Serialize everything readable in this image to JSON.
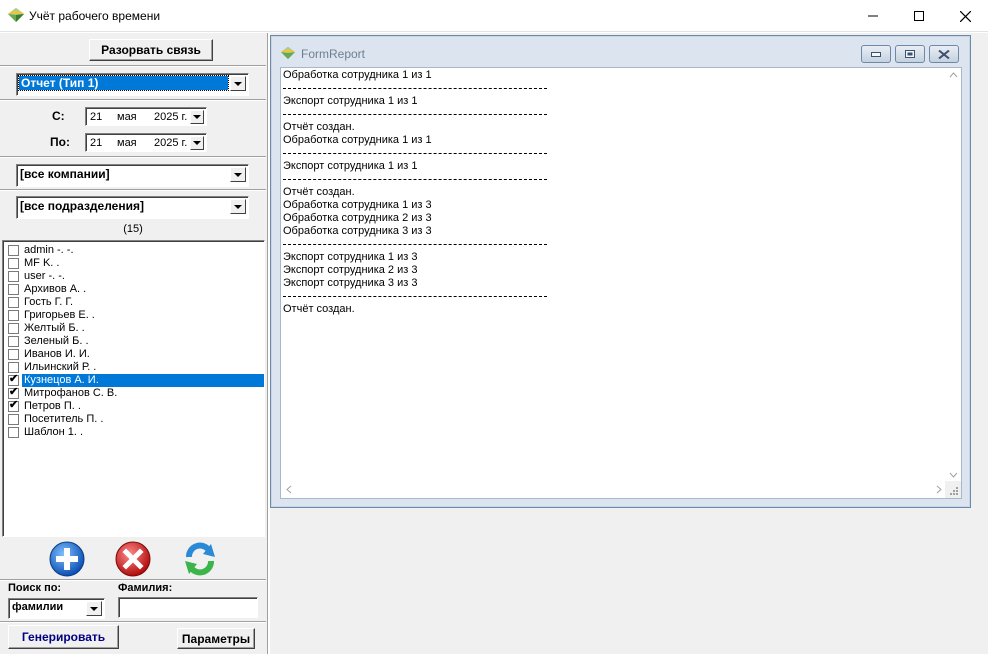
{
  "window": {
    "title": "Учёт рабочего времени"
  },
  "left": {
    "disconnect_label": "Разорвать связь",
    "report_type": "Отчет (Тип 1)",
    "from_label": "С:",
    "to_label": "По:",
    "date_from": {
      "day": "21",
      "month": "мая",
      "year": "2025 г."
    },
    "date_to": {
      "day": "21",
      "month": "мая",
      "year": "2025 г."
    },
    "company": "[все компании]",
    "department": "[все подразделения]",
    "count": "(15)",
    "employees": [
      {
        "name": "admin -. -.",
        "checked": false,
        "selected": false
      },
      {
        "name": "MF K. .",
        "checked": false,
        "selected": false
      },
      {
        "name": "user -. -.",
        "checked": false,
        "selected": false
      },
      {
        "name": "Архивов А. .",
        "checked": false,
        "selected": false
      },
      {
        "name": "Гость Г. Г.",
        "checked": false,
        "selected": false
      },
      {
        "name": "Григорьев Е. .",
        "checked": false,
        "selected": false
      },
      {
        "name": "Желтый Б. .",
        "checked": false,
        "selected": false
      },
      {
        "name": "Зеленый Б. .",
        "checked": false,
        "selected": false
      },
      {
        "name": "Иванов И. И.",
        "checked": false,
        "selected": false
      },
      {
        "name": "Ильинский Р. .",
        "checked": false,
        "selected": false
      },
      {
        "name": "Кузнецов А. И.",
        "checked": true,
        "selected": true
      },
      {
        "name": "Митрофанов С. В.",
        "checked": true,
        "selected": false
      },
      {
        "name": "Петров П. .",
        "checked": true,
        "selected": false
      },
      {
        "name": "Посетитель П. .",
        "checked": false,
        "selected": false
      },
      {
        "name": "Шаблон 1. .",
        "checked": false,
        "selected": false
      }
    ],
    "search_by_label": "Поиск по:",
    "search_by_value": "фамилии",
    "lastname_label": "Фамилия:",
    "lastname_value": "",
    "generate_label": "Генерировать",
    "params_label": "Параметры"
  },
  "report_window": {
    "title": "FormReport",
    "lines": [
      {
        "type": "text",
        "text": "Обработка сотрудника 1 из 1"
      },
      {
        "type": "sep"
      },
      {
        "type": "text",
        "text": "Экспорт сотрудника 1 из 1"
      },
      {
        "type": "sep"
      },
      {
        "type": "text",
        "text": "Отчёт создан."
      },
      {
        "type": "text",
        "text": "Обработка сотрудника 1 из 1"
      },
      {
        "type": "sep"
      },
      {
        "type": "text",
        "text": "Экспорт сотрудника 1 из 1"
      },
      {
        "type": "sep"
      },
      {
        "type": "text",
        "text": "Отчёт создан."
      },
      {
        "type": "text",
        "text": "Обработка сотрудника 1 из 3"
      },
      {
        "type": "text",
        "text": "Обработка сотрудника 2 из 3"
      },
      {
        "type": "text",
        "text": "Обработка сотрудника 3 из 3"
      },
      {
        "type": "sep"
      },
      {
        "type": "text",
        "text": "Экспорт сотрудника 1 из 3"
      },
      {
        "type": "text",
        "text": "Экспорт сотрудника 2 из 3"
      },
      {
        "type": "text",
        "text": "Экспорт сотрудника 3 из 3"
      },
      {
        "type": "sep"
      },
      {
        "type": "text",
        "text": "Отчёт создан."
      }
    ]
  },
  "colors": {
    "selection": "#0078d7",
    "add_button": "#1a6fd6",
    "delete_button": "#d42020",
    "refresh_button": "#2a8ad6",
    "generate_text": "#000080"
  },
  "icons": {
    "app": "diamond-icon",
    "add": "plus-icon",
    "delete": "x-icon",
    "refresh": "refresh-icon"
  }
}
